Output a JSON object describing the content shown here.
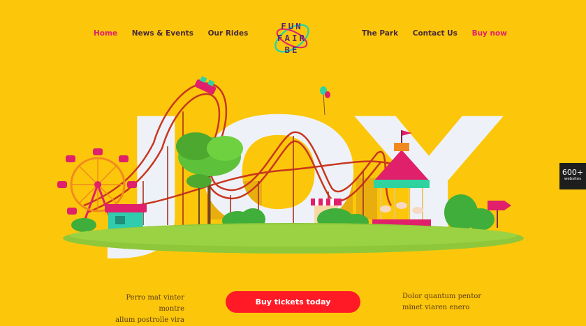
{
  "nav_left": [
    "Home",
    "News & Events",
    "Our Rides"
  ],
  "nav_right": [
    "The Park",
    "Contact Us",
    "Buy now"
  ],
  "logo": {
    "line1": "FUN",
    "line2": "FAIR",
    "line3": "BE"
  },
  "hero": {
    "word": "JOY"
  },
  "badge": {
    "count": "600+",
    "label": "websites"
  },
  "tagline_left": {
    "line1": "Perro mat vinter montre",
    "line2": "allum postrolle vira"
  },
  "tagline_right": {
    "line1": "Dolor quantum pentor",
    "line2": "minet viaren enero"
  },
  "cta": {
    "label": "Buy tickets today"
  },
  "colors": {
    "background": "#FCC70B",
    "accent": "#E0206A",
    "cta": "#FF1A26",
    "letters": "#EEF2F8"
  }
}
